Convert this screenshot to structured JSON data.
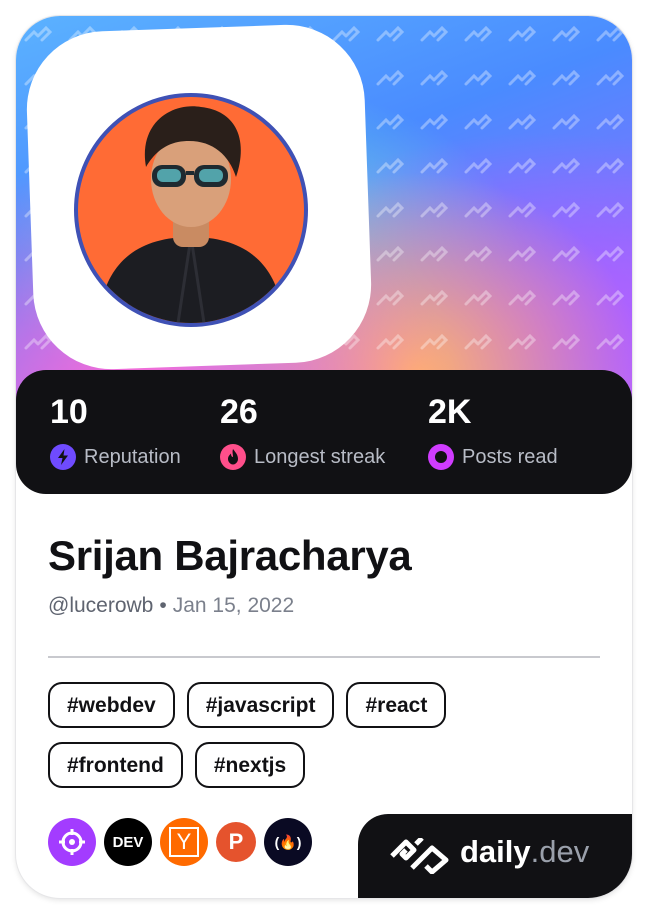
{
  "profile": {
    "name": "Srijan Bajracharya",
    "handle": "@lucerowb",
    "joined": "Jan 15, 2022"
  },
  "stats": [
    {
      "value": "10",
      "label": "Reputation",
      "icon": "bolt-icon",
      "color": "#6f4bff"
    },
    {
      "value": "26",
      "label": "Longest streak",
      "icon": "flame-icon",
      "color": "#ff4f8b"
    },
    {
      "value": "2K",
      "label": "Posts read",
      "icon": "eye-ring-icon",
      "color": "#d03cff"
    }
  ],
  "tags": [
    "#webdev",
    "#javascript",
    "#react",
    "#frontend",
    "#nextjs"
  ],
  "sources": [
    {
      "name": "crosshair-source-icon",
      "color": "#a33cff"
    },
    {
      "name": "dev-source-icon",
      "label": "DEV",
      "color": "#000000"
    },
    {
      "name": "ycombinator-source-icon",
      "label": "Y",
      "color": "#ff6a00"
    },
    {
      "name": "producthunt-source-icon",
      "label": "P",
      "color": "#e5532d"
    },
    {
      "name": "freecodecamp-source-icon",
      "label": "(🔥)",
      "color": "#0a0a23"
    }
  ],
  "brand": {
    "name": "daily",
    "suffix": ".dev"
  }
}
